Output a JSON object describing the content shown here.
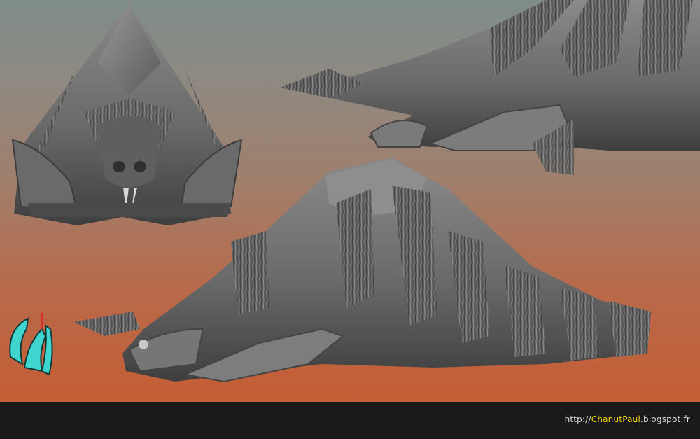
{
  "credit": {
    "prefix": "http://",
    "name": "ChanutPaul",
    "suffix": ".blogspot.fr"
  },
  "colors": {
    "background_top": "#7f8c8a",
    "background_bottom": "#c55d35",
    "sculpt_gray": "#6e6e6e",
    "footer": "#1a1a1a",
    "credit_highlight": "#f2d000",
    "logo_cyan": "#3fd6d0"
  },
  "icons": {
    "logo": "claw-logo-icon"
  }
}
